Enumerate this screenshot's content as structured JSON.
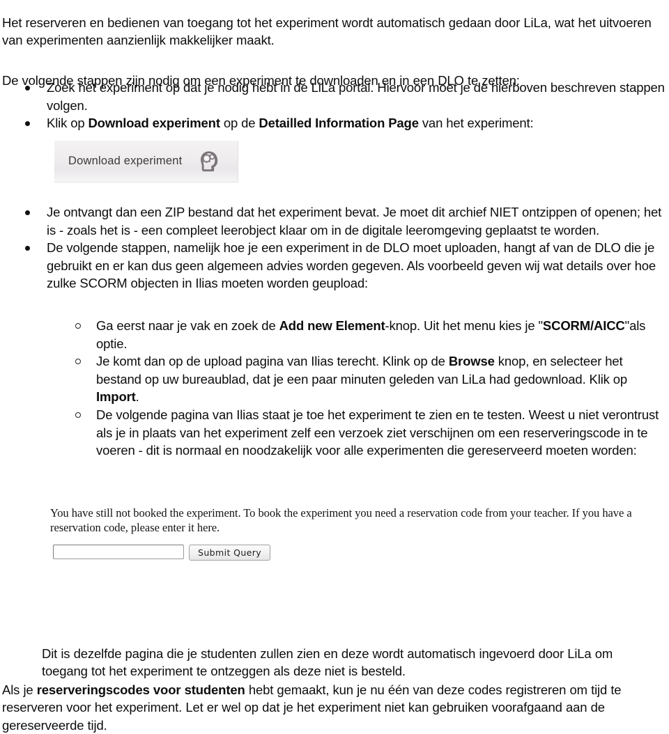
{
  "document": {
    "intro_paragraph": "Het reserveren en bedienen van toegang tot het experiment wordt automatisch gedaan door LiLa, wat het uitvoeren van experimenten aanzienlijk makkelijker maakt.",
    "lead_in": "De volgende stappen zijn nodig om een experiment te downloaden en in een DLO te zetten:",
    "bullets": {
      "b1": {
        "text_1": "Zoek het experiment op dat je nodig hebt in de LiLa portal. Hiervoor moet je de hierboven beschreven stappen volgen."
      },
      "b2": {
        "text_1": "Klik op ",
        "bold_1": "Download experiment",
        "text_2": " op de ",
        "bold_2": "Detailled Information Page",
        "text_3": " van het experiment:"
      },
      "b3": {
        "text_1": "Je ontvangt dan een ZIP bestand dat het experiment bevat. Je  moet dit archief NIET ontzippen of openen; het is - zoals het is - een compleet leerobject klaar om  in de digitale leeromgeving geplaatst te worden."
      },
      "b4": {
        "text_1": "De volgende stappen, namelijk hoe je een experiment in de DLO moet uploaden, hangt af van de DLO die je gebruikt en er kan dus geen algemeen advies worden gegeven. Als voorbeeld geven wij wat details over hoe zulke SCORM objecten in Ilias moeten worden geupload:"
      }
    },
    "subbullets": {
      "s1": {
        "text_1": "Ga eerst naar je vak en zoek de ",
        "bold_1": "Add new Element",
        "text_2": "-knop. Uit het menu kies je \"",
        "bold_2": "SCORM/AICC",
        "text_3": "\"als optie."
      },
      "s2": {
        "text_1": "Je komt dan op de upload pagina van Ilias terecht. Klink op de ",
        "bold_1": "Browse",
        "text_2": " knop, en selecteer het bestand op uw bureaublad, dat je  een paar minuten geleden van LiLa had gedownload. Klik op ",
        "bold_2": "Import",
        "text_3": "."
      },
      "s3": {
        "text_1": "De volgende pagina van Ilias staat je toe het experiment te  zien en te testen. Weest u niet verontrust als je in plaats van  het experiment zelf een verzoek ziet verschijnen om een reserveringscode in te voeren - dit is normaal en noodzakelijk voor alle experimenten die gereserveerd moeten worden:"
      }
    },
    "closing": {
      "indented": "Dit is dezelfde pagina die je  studenten zullen zien en deze wordt automatisch ingevoerd door LiLa om toegang tot het experiment te ontzeggen als deze niet is besteld.",
      "full_1": "Als je  ",
      "full_bold": "reserveringscodes voor studenten",
      "full_2": " hebt gemaakt, kun je nu één van deze codes registreren om tijd te reserveren voor het experiment. Let er wel op dat je het experiment niet kan gebruiken voorafgaand aan de gereserveerde tijd."
    }
  },
  "download_button_image": {
    "label": "Download experiment",
    "icon": "head-with-gears-icon",
    "background_start": "#f4f2f3",
    "background_end": "#e9e7e9",
    "text_color": "#3b3b3b",
    "icon_color": "#7b7478"
  },
  "reservation_screenshot": {
    "message": "You have still not booked the experiment. To book the experiment you need a reservation code from your teacher. If you have a reservation code, please enter it here.",
    "input_value": "",
    "input_placeholder": "",
    "submit_label": "Submit Query"
  }
}
